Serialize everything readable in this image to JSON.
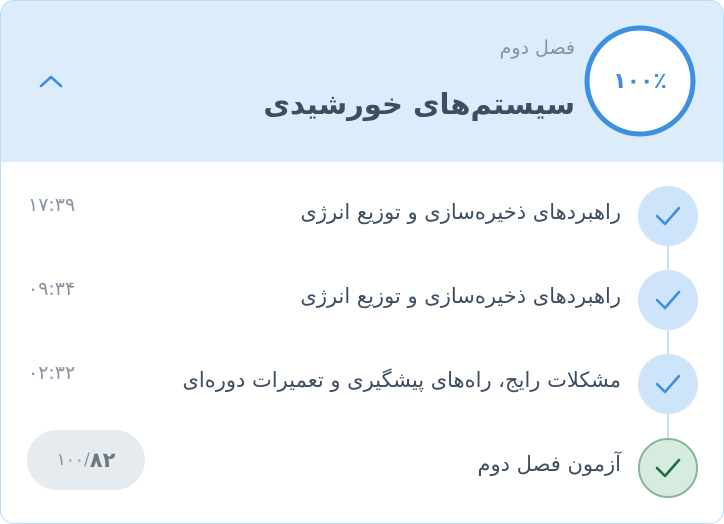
{
  "section": {
    "subtitle": "فصل دوم",
    "title": "سیستم‌های خورشیدی",
    "progress_label": "۱۰۰٪",
    "progress": 1.0
  },
  "lessons": [
    {
      "title": "راهبردهای ذخیره‌سازی و توزیع انرژی",
      "duration": "۱۷:۳۹",
      "status": "completed"
    },
    {
      "title": "راهبردهای ذخیره‌سازی و توزیع انرژی",
      "duration": "۰۹:۳۴",
      "status": "completed"
    },
    {
      "title": "مشکلات رایج، راه‌های پیشگیری و تعمیرات دوره‌ای",
      "duration": "۰۲:۳۲",
      "status": "completed"
    }
  ],
  "exam": {
    "title": "آزمون فصل دوم",
    "score": "۸۲",
    "total": "/۱۰۰",
    "status": "passed"
  },
  "icons": {
    "collapse": "chevron-up-icon",
    "lesson_check": "check-icon"
  },
  "colors": {
    "accent": "#3d8fe0",
    "header_bg": "#dcecfb",
    "passed_green": "#1f6e3c"
  }
}
